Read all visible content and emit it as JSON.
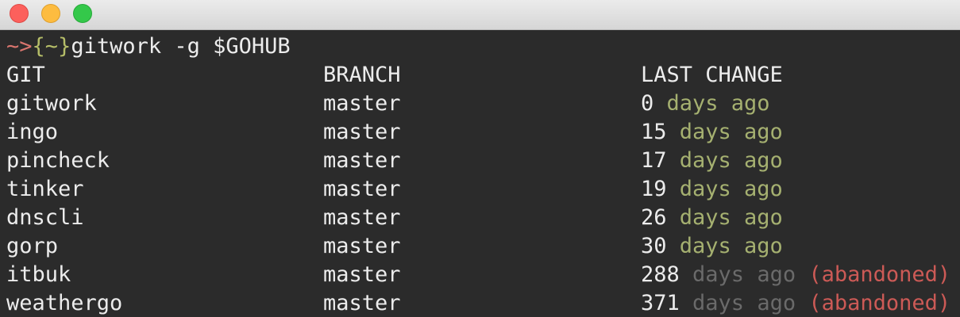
{
  "window": {
    "buttons": {
      "close": "close-button",
      "minimize": "minimize-button",
      "zoom": "zoom-button"
    }
  },
  "prompt": {
    "arrow": "~>",
    "brace_open": "{",
    "cwd": "~",
    "brace_close": "}",
    "command": "gitwork -g $GOHUB"
  },
  "headers": {
    "git": "GIT",
    "branch": "BRANCH",
    "last_change": "LAST CHANGE"
  },
  "rows": [
    {
      "git": "gitwork",
      "branch": "master",
      "days": "0",
      "unit": " days ago",
      "status": "recent",
      "note": ""
    },
    {
      "git": "ingo",
      "branch": "master",
      "days": "15",
      "unit": " days ago",
      "status": "recent",
      "note": ""
    },
    {
      "git": "pincheck",
      "branch": "master",
      "days": "17",
      "unit": " days ago",
      "status": "recent",
      "note": ""
    },
    {
      "git": "tinker",
      "branch": "master",
      "days": "19",
      "unit": " days ago",
      "status": "recent",
      "note": ""
    },
    {
      "git": "dnscli",
      "branch": "master",
      "days": "26",
      "unit": " days ago",
      "status": "recent",
      "note": ""
    },
    {
      "git": "gorp",
      "branch": "master",
      "days": "30",
      "unit": " days ago",
      "status": "recent",
      "note": ""
    },
    {
      "git": "itbuk",
      "branch": "master",
      "days": "288",
      "unit": " days ago",
      "status": "stale",
      "note": " (abandoned)"
    },
    {
      "git": "weathergo",
      "branch": "master",
      "days": "371",
      "unit": " days ago",
      "status": "stale",
      "note": " (abandoned)"
    }
  ],
  "colors": {
    "background": "#2b2b2b",
    "text": "#ececec",
    "recent": "#a5b070",
    "stale": "#6a6a6a",
    "abandoned": "#cc5a56",
    "prompt_arrow": "#d9756e",
    "prompt_brace": "#b5bd68"
  }
}
